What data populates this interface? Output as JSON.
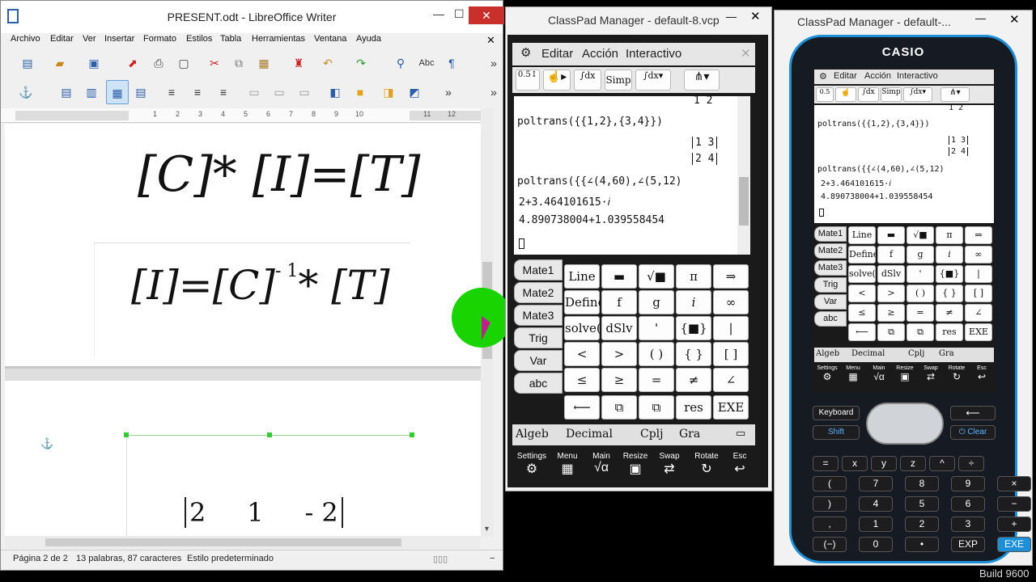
{
  "libreoffice": {
    "title": "PRESENT.odt - LibreOffice Writer",
    "menu": [
      "Archivo",
      "Editar",
      "Ver",
      "Insertar",
      "Formato",
      "Estilos",
      "Tabla",
      "Herramientas",
      "Ventana",
      "Ayuda"
    ],
    "equations": {
      "eq1": "[C]* [I]=[T]",
      "eq2_a": "[I]=[C]",
      "eq2_exp": "- 1",
      "eq2_b": "* [T]",
      "matrix_row": "2     1     - 2"
    },
    "ruler_numbers": [
      "1",
      "2",
      "3",
      "4",
      "5",
      "6",
      "7",
      "8",
      "9",
      "10",
      "11",
      "12"
    ],
    "status": {
      "page": "Página 2 de 2",
      "words": "13 palabras, 87 caracteres",
      "style": "Estilo predeterminado"
    }
  },
  "classpad1": {
    "title": "ClassPad Manager - default-8.vcp",
    "menu": [
      "Editar",
      "Acción",
      "Interactivo"
    ],
    "toolbar": [
      "Simp"
    ],
    "display": {
      "top_matrix": "1  2",
      "line1": "poltrans({{1,2},{3,4}})",
      "m1r1": "1  3",
      "m1r2": "2  4",
      "line2": "poltrans({{∠(4,60),∠(5,12)",
      "r1": "2+3.464101615·𝑖",
      "r2": "4.890738004+1.039558454"
    },
    "tabs": [
      "Mate1",
      "Mate2",
      "Mate3",
      "Trig",
      "Var",
      "abc"
    ],
    "keys": [
      [
        "Line",
        "▬",
        "√■",
        "π",
        "⇒"
      ],
      [
        "Define",
        "f",
        "g",
        "𝑖",
        "∞"
      ],
      [
        "solve(",
        "dSlv",
        "'",
        "{■}",
        "|"
      ],
      [
        "<",
        ">",
        "( )",
        "{ }",
        "[ ]"
      ],
      [
        "≤",
        "≥",
        "=",
        "≠",
        "∠"
      ],
      [
        "⟵",
        "⧉",
        "⧉",
        "res",
        "EXE"
      ]
    ],
    "statusbar": [
      "Algeb",
      "Decimal",
      "Cplj",
      "Gra"
    ],
    "iconbar": [
      "Settings",
      "Menu",
      "Main",
      "Resize",
      "Swap",
      "Rotate",
      "Esc"
    ]
  },
  "classpad2": {
    "title": "ClassPad Manager - default-...",
    "brand": "CASIO",
    "menu": [
      "Editar",
      "Acción",
      "Interactivo"
    ],
    "display": {
      "top_matrix": "1  2",
      "line1": "poltrans({{1,2},{3,4}})",
      "m1r1": "1  3",
      "m1r2": "2  4",
      "line2": "poltrans({{∠(4,60),∠(5,12)",
      "r1": "2+3.464101615·𝑖",
      "r2": "4.890738004+1.039558454"
    },
    "tabs": [
      "Mate1",
      "Mate2",
      "Mate3",
      "Trig",
      "Var",
      "abc"
    ],
    "keys": [
      [
        "Line",
        "▬",
        "√■",
        "π",
        "⇒"
      ],
      [
        "Define",
        "f",
        "g",
        "𝑖",
        "∞"
      ],
      [
        "solve(",
        "dSlv",
        "'",
        "{■}",
        "|"
      ],
      [
        "<",
        ">",
        "( )",
        "{ }",
        "[ ]"
      ],
      [
        "≤",
        "≥",
        "=",
        "≠",
        "∠"
      ],
      [
        "⟵",
        "⧉",
        "⧉",
        "res",
        "EXE"
      ]
    ],
    "statusbar": [
      "Algeb",
      "Decimal",
      "Cplj",
      "Gra"
    ],
    "iconbar": [
      "Settings",
      "Menu",
      "Main",
      "Resize",
      "Swap",
      "Rotate",
      "Esc"
    ],
    "hw_top": {
      "keyboard": "Keyboard",
      "shift": "Shift",
      "clear": "Clear"
    },
    "hw_keys": [
      [
        "=",
        "x",
        "y",
        "z",
        "^",
        "÷"
      ],
      [
        "(",
        "7",
        "8",
        "9",
        "×"
      ],
      [
        ")",
        "4",
        "5",
        "6",
        "−"
      ],
      [
        ",",
        "1",
        "2",
        "3",
        "+"
      ],
      [
        "(−)",
        "0",
        "•",
        "EXP",
        "EXE"
      ]
    ]
  },
  "build": "Build 9600",
  "colors": {
    "cursor_highlight": "#19d400",
    "close_red": "#c9302c",
    "calc_accent": "#1e8fd6"
  }
}
